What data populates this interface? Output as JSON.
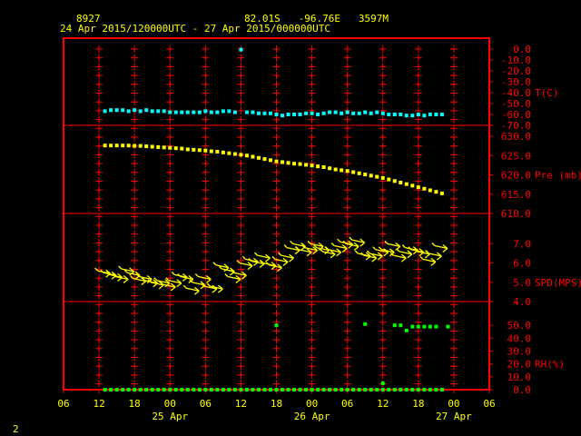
{
  "header": {
    "station_id": "8927",
    "location": "82.01S   -96.76E   3597M",
    "time_range": "24 Apr 2015/120000UTC - 27 Apr 2015/000000UTC"
  },
  "footer": {
    "page_number": "2"
  },
  "colors": {
    "background": "#000000",
    "frame": "#ff0000",
    "grid": "#ff0000",
    "label": "#ffff00",
    "temperature": "#00ffff",
    "pressure": "#ffff00",
    "wind": "#ffff00",
    "humidity": "#00ff00"
  },
  "x_axis": {
    "unit": "hours since 24 Apr 00UTC",
    "range": [
      30,
      102
    ],
    "ticks": [
      {
        "h": 30,
        "label": "06"
      },
      {
        "h": 36,
        "label": "12"
      },
      {
        "h": 42,
        "label": "18"
      },
      {
        "h": 48,
        "label": "00"
      },
      {
        "h": 54,
        "label": "06"
      },
      {
        "h": 60,
        "label": "12"
      },
      {
        "h": 66,
        "label": "18"
      },
      {
        "h": 72,
        "label": "00"
      },
      {
        "h": 78,
        "label": "06"
      },
      {
        "h": 84,
        "label": "12"
      },
      {
        "h": 90,
        "label": "18"
      },
      {
        "h": 96,
        "label": "00"
      },
      {
        "h": 102,
        "label": "06"
      }
    ],
    "day_labels": [
      {
        "h": 48,
        "label": "25 Apr"
      },
      {
        "h": 72,
        "label": "26 Apr"
      },
      {
        "h": 96,
        "label": "27 Apr"
      }
    ]
  },
  "chart_data": [
    {
      "type": "scatter",
      "panel": "temperature",
      "ylabel": "T(C)",
      "ylim": [
        -70,
        0
      ],
      "yticks": [
        "0.0",
        "-10.0",
        "-20.0",
        "-30.0",
        "-40.0",
        "-50.0",
        "-60.0",
        "-70.0"
      ],
      "x": [
        37,
        38,
        39,
        40,
        41,
        42,
        43,
        44,
        45,
        46,
        47,
        48,
        49,
        50,
        51,
        52,
        53,
        54,
        55,
        56,
        57,
        58,
        59,
        60,
        61,
        62,
        63,
        64,
        65,
        66,
        67,
        68,
        69,
        70,
        71,
        72,
        73,
        74,
        75,
        76,
        77,
        78,
        79,
        80,
        81,
        82,
        83,
        84,
        85,
        86,
        87,
        88,
        89,
        90,
        91,
        92,
        93,
        94
      ],
      "y": [
        -57,
        -56,
        -56,
        -56,
        -57,
        -56,
        -57,
        -56,
        -57,
        -57,
        -57,
        -58,
        -58,
        -58,
        -58,
        -58,
        -58,
        -57,
        -58,
        -58,
        -57,
        -57,
        -58,
        -0.5,
        -58,
        -58,
        -59,
        -59,
        -59,
        -60,
        -61,
        -60,
        -60,
        -60,
        -59,
        -59,
        -60,
        -59,
        -58,
        -58,
        -59,
        -58,
        -59,
        -59,
        -58,
        -59,
        -58,
        -59,
        -60,
        -60,
        -60,
        -61,
        -61,
        -60,
        -61,
        -60,
        -60,
        -60
      ]
    },
    {
      "type": "scatter",
      "panel": "pressure",
      "ylabel": "Pre (mb)",
      "ylim": [
        610,
        630
      ],
      "yticks": [
        "630.0",
        "625.0",
        "620.0",
        "615.0",
        "610.0"
      ],
      "x": [
        37,
        38,
        39,
        40,
        41,
        42,
        43,
        44,
        45,
        46,
        47,
        48,
        49,
        50,
        51,
        52,
        53,
        54,
        55,
        56,
        57,
        58,
        59,
        60,
        61,
        62,
        63,
        64,
        65,
        66,
        67,
        68,
        69,
        70,
        71,
        72,
        73,
        74,
        75,
        76,
        77,
        78,
        79,
        80,
        81,
        82,
        83,
        84,
        85,
        86,
        87,
        88,
        89,
        90,
        91,
        92,
        93,
        94
      ],
      "y": [
        627.6,
        627.6,
        627.6,
        627.6,
        627.6,
        627.5,
        627.5,
        627.4,
        627.3,
        627.2,
        627.1,
        627.0,
        626.9,
        626.8,
        626.6,
        626.5,
        626.4,
        626.3,
        626.1,
        626.0,
        625.8,
        625.6,
        625.4,
        625.2,
        625.0,
        624.7,
        624.4,
        624.1,
        623.8,
        623.5,
        623.3,
        623.1,
        622.9,
        622.8,
        622.6,
        622.4,
        622.2,
        622.0,
        621.7,
        621.4,
        621.2,
        621.0,
        620.7,
        620.4,
        620.1,
        619.8,
        619.5,
        619.2,
        618.8,
        618.4,
        618.0,
        617.6,
        617.2,
        616.8,
        616.4,
        616.0,
        615.6,
        615.2
      ]
    },
    {
      "type": "scatter",
      "panel": "wind",
      "ylabel": "SPD(MPS)",
      "ylim": [
        4,
        8
      ],
      "yticks": [
        "7.0",
        "6.0",
        "5.0",
        "4.0"
      ],
      "x": [
        37,
        38,
        39,
        40,
        41,
        42,
        43,
        44,
        45,
        46,
        47,
        48,
        49,
        50,
        51,
        52,
        53,
        54,
        55,
        56,
        57,
        58,
        59,
        60,
        61,
        62,
        63,
        64,
        65,
        66,
        67,
        68,
        69,
        70,
        71,
        72,
        73,
        74,
        75,
        76,
        77,
        78,
        79,
        80,
        81,
        82,
        83,
        84,
        85,
        86,
        87,
        88,
        89,
        90,
        91,
        92,
        93,
        94
      ],
      "y": [
        5.5,
        5.4,
        5.3,
        5.2,
        5.6,
        5.4,
        5.1,
        5.2,
        5.0,
        4.9,
        5.0,
        4.8,
        5.0,
        5.3,
        5.2,
        4.6,
        4.9,
        5.2,
        4.7,
        4.7,
        5.8,
        5.6,
        5.2,
        5.4,
        5.9,
        6.1,
        6.0,
        6.3,
        5.9,
        5.8,
        6.1,
        6.3,
        6.7,
        6.9,
        6.6,
        6.7,
        6.9,
        6.7,
        6.5,
        6.6,
        6.8,
        7.0,
        6.9,
        7.1,
        6.4,
        6.3,
        6.4,
        6.6,
        6.6,
        6.9,
        6.3,
        6.5,
        6.7,
        6.6,
        6.5,
        6.1,
        6.4,
        6.8
      ],
      "glyph": "wind-arrow"
    },
    {
      "type": "scatter",
      "panel": "humidity",
      "ylabel": "RH(%)",
      "ylim": [
        0,
        60
      ],
      "yticks": [
        "50.0",
        "40.0",
        "30.0",
        "20.0",
        "10.0",
        "0.0"
      ],
      "x": [
        37,
        38,
        39,
        40,
        41,
        42,
        43,
        44,
        45,
        46,
        47,
        48,
        49,
        50,
        51,
        52,
        53,
        54,
        55,
        56,
        57,
        58,
        59,
        60,
        61,
        62,
        63,
        64,
        65,
        66,
        67,
        68,
        69,
        70,
        71,
        72,
        73,
        74,
        75,
        76,
        77,
        78,
        79,
        80,
        81,
        82,
        83,
        84,
        85,
        86,
        87,
        88,
        89,
        90,
        91,
        92,
        93,
        94,
        66,
        81,
        84,
        86,
        87,
        88,
        89,
        90,
        91,
        92,
        93,
        95
      ],
      "y": [
        0,
        0,
        0,
        0,
        0,
        0,
        0,
        0,
        0,
        0,
        0,
        0,
        0,
        0,
        0,
        0,
        0,
        0,
        0,
        0,
        0,
        0,
        0,
        0,
        0,
        0,
        0,
        0,
        0,
        0,
        0,
        0,
        0,
        0,
        0,
        0,
        0,
        0,
        0,
        0,
        0,
        0,
        0,
        0,
        0,
        0,
        0,
        0,
        0,
        0,
        0,
        0,
        0,
        0,
        0,
        0,
        0,
        0,
        50,
        51,
        5,
        50,
        50,
        46,
        49,
        49,
        49,
        49,
        49,
        49
      ]
    }
  ]
}
